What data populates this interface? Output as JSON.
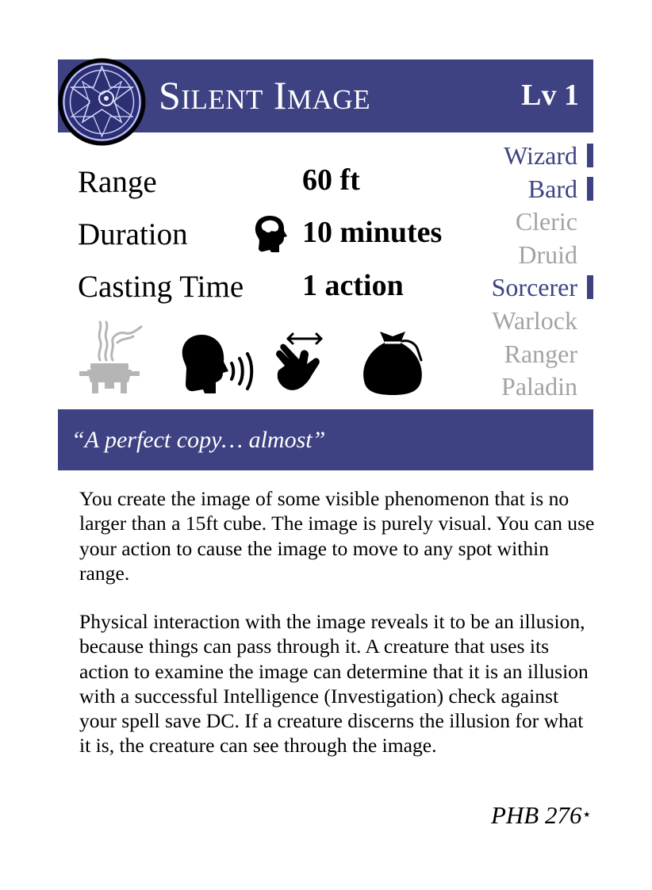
{
  "card": {
    "title": "Silent Image",
    "level": "Lv 1",
    "accent_color": "#3e4283",
    "inactive_color": "#a3a3a3",
    "emblem_icon": "illusion-school-emblem-icon"
  },
  "stats": {
    "range_label": "Range",
    "range_value": "60 ft",
    "duration_label": "Duration",
    "duration_value": "10 minutes",
    "concentration_icon": "concentration-head-icon",
    "casting_time_label": "Casting Time",
    "casting_time_value": "1 action"
  },
  "classes": [
    {
      "name": "Wizard",
      "active": true
    },
    {
      "name": "Bard",
      "active": true
    },
    {
      "name": "Cleric",
      "active": false
    },
    {
      "name": "Druid",
      "active": false
    },
    {
      "name": "Sorcerer",
      "active": true
    },
    {
      "name": "Warlock",
      "active": false
    },
    {
      "name": "Ranger",
      "active": false
    },
    {
      "name": "Paladin",
      "active": false
    }
  ],
  "components": [
    {
      "icon": "ritual-incense-icon",
      "active": false
    },
    {
      "icon": "verbal-speaking-head-icon",
      "active": true
    },
    {
      "icon": "somatic-hand-icon",
      "active": true
    },
    {
      "icon": "material-pouch-icon",
      "active": true
    }
  ],
  "quote": "“A perfect copy… almost”",
  "description": [
    "You create the image of some visible phenomenon that is no larger than a 15ft cube. The image is purely visual. You can use your action to cause the image to move to any spot within range.",
    "Physical interaction with the image reveals it to be an illusion, because things can pass through it. A creature that uses its action to examine the image can determine that it is an illusion with a successful Intelligence (Investigation) check against your spell save DC. If a creature discerns the illusion for what it is, the creature can see through the image."
  ],
  "source": {
    "text": "PHB 276",
    "marker": "⋆"
  }
}
